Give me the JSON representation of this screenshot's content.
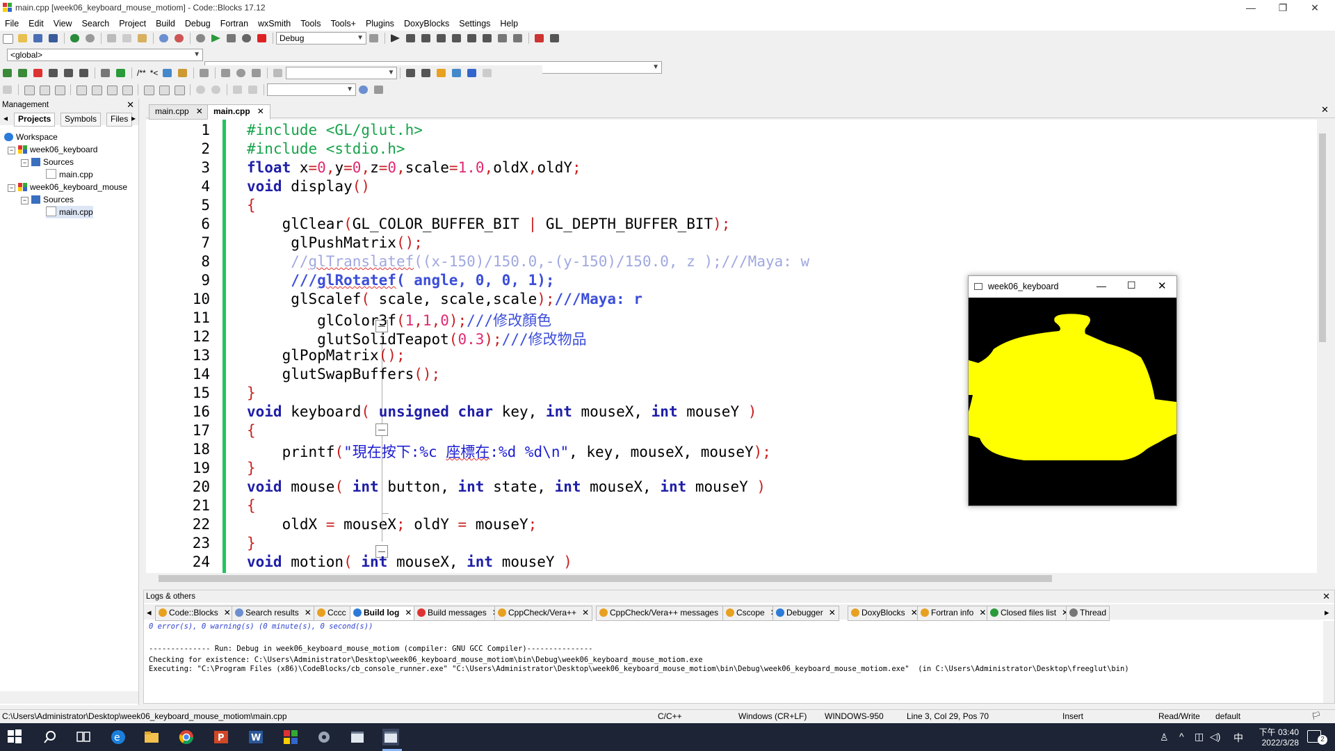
{
  "window": {
    "title": "main.cpp [week06_keyboard_mouse_motiom] - Code::Blocks 17.12",
    "minimize": "—",
    "maximize": "❐",
    "close": "✕"
  },
  "menu": [
    "File",
    "Edit",
    "View",
    "Search",
    "Project",
    "Build",
    "Debug",
    "Fortran",
    "wxSmith",
    "Tools",
    "Tools+",
    "Plugins",
    "DoxyBlocks",
    "Settings",
    "Help"
  ],
  "toolbar": {
    "build_target": "Debug",
    "scope_combo": "<global>",
    "comment_labels": [
      "/**",
      "*<"
    ]
  },
  "management": {
    "title": "Management",
    "tabs": [
      "Projects",
      "Symbols",
      "Files"
    ],
    "tree": [
      {
        "label": "Workspace"
      },
      {
        "label": "week06_keyboard"
      },
      {
        "label": "Sources"
      },
      {
        "label": "main.cpp"
      },
      {
        "label": "week06_keyboard_mouse"
      },
      {
        "label": "Sources"
      },
      {
        "label": "main.cpp"
      }
    ]
  },
  "editor": {
    "tabs": [
      {
        "label": "main.cpp",
        "active": false
      },
      {
        "label": "main.cpp",
        "active": true
      }
    ],
    "line_numbers": [
      "1",
      "2",
      "3",
      "4",
      "5",
      "6",
      "7",
      "8",
      "9",
      "10",
      "11",
      "12",
      "13",
      "14",
      "15",
      "16",
      "17",
      "18",
      "19",
      "20",
      "21",
      "22",
      "23",
      "24"
    ]
  },
  "gl_window": {
    "title": "week06_keyboard",
    "teapot_color": "#ffff00",
    "background": "#000000"
  },
  "logs": {
    "title": "Logs & others",
    "tabs": [
      "Code::Blocks",
      "Search results",
      "Cccc",
      "Build log",
      "Build messages",
      "CppCheck/Vera++",
      "CppCheck/Vera++ messages",
      "Cscope",
      "Debugger",
      "DoxyBlocks",
      "Fortran info",
      "Closed files list",
      "Thread"
    ],
    "lines": [
      "0 error(s), 0 warning(s) (0 minute(s), 0 second(s))",
      "-------------- Run: Debug in week06_keyboard_mouse_motiom (compiler: GNU GCC Compiler)---------------",
      "Checking for existence: C:\\Users\\Administrator\\Desktop\\week06_keyboard_mouse_motiom\\bin\\Debug\\week06_keyboard_mouse_motiom.exe",
      "Executing: \"C:\\Program Files (x86)\\CodeBlocks/cb_console_runner.exe\" \"C:\\Users\\Administrator\\Desktop\\week06_keyboard_mouse_motiom\\bin\\Debug\\week06_keyboard_mouse_motiom.exe\"  (in C:\\Users\\Administrator\\Desktop\\freeglut\\bin)"
    ]
  },
  "status": {
    "path": "C:\\Users\\Administrator\\Desktop\\week06_keyboard_mouse_motiom\\main.cpp",
    "lang": "C/C++",
    "eol": "Windows (CR+LF)",
    "encoding": "WINDOWS-950",
    "position": "Line 3, Col 29, Pos 70",
    "mode": "Insert",
    "access": "Read/Write",
    "profile": "default"
  },
  "taskbar": {
    "time": "下午 03:40",
    "date": "2022/3/28",
    "ime": "中",
    "notifications": "2"
  }
}
